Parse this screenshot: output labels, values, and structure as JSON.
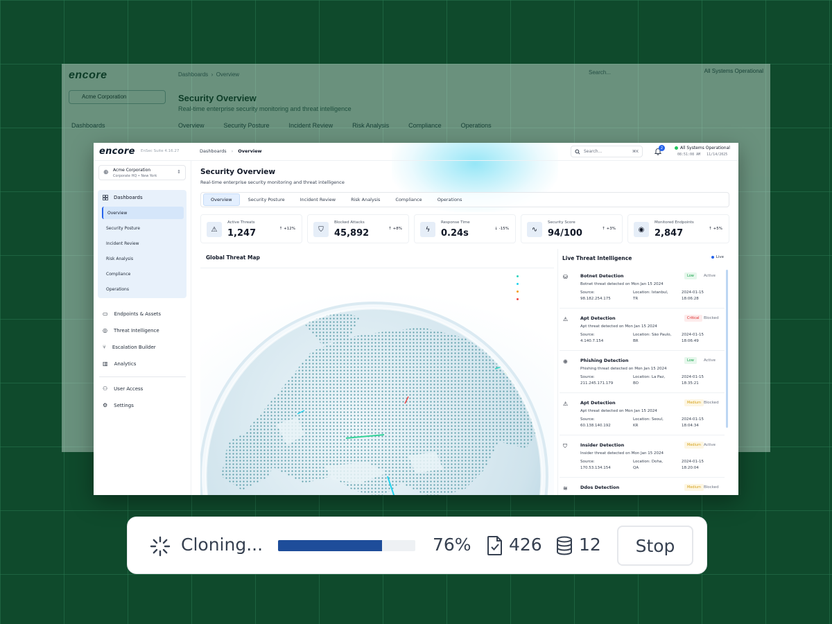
{
  "background_app": {
    "logo": "encore",
    "title": "Security Overview",
    "subtitle": "Real-time enterprise security monitoring and threat intelligence",
    "breadcrumb": [
      "Dashboards",
      "Overview"
    ],
    "tabs": [
      "Overview",
      "Security Posture",
      "Incident Review",
      "Risk Analysis",
      "Compliance",
      "Operations"
    ],
    "org_name": "Acme Corporation",
    "nav_dashboards": "Dashboards",
    "search": "Search...",
    "status": "All Systems Operational"
  },
  "app": {
    "logo": "encore",
    "version": "EnSec Suite 4.16.27",
    "breadcrumb": {
      "parent": "Dashboards",
      "current": "Overview"
    },
    "search": {
      "placeholder": "Search...",
      "shortcut": "⌘K"
    },
    "notifications": {
      "count": "2"
    },
    "system": {
      "status": "All Systems Operational",
      "time": "08:51:08 AM",
      "date": "11/14/2025"
    }
  },
  "sidebar": {
    "org": {
      "name": "Acme Corporation",
      "location": "Corporate HQ • New York"
    },
    "dashboards": {
      "label": "Dashboards",
      "items": [
        "Overview",
        "Security Posture",
        "Incident Review",
        "Risk Analysis",
        "Compliance",
        "Operations"
      ]
    },
    "items": [
      {
        "label": "Endpoints & Assets",
        "icon": "laptop-icon"
      },
      {
        "label": "Threat Intelligence",
        "icon": "radar-icon"
      },
      {
        "label": "Escalation Builder",
        "icon": "branch-icon"
      },
      {
        "label": "Analytics",
        "icon": "chart-icon"
      }
    ],
    "items2": [
      {
        "label": "User Access",
        "icon": "users-icon"
      },
      {
        "label": "Settings",
        "icon": "gear-icon"
      }
    ]
  },
  "main": {
    "title": "Security Overview",
    "subtitle": "Real-time enterprise security monitoring and threat intelligence",
    "tabs": [
      "Overview",
      "Security Posture",
      "Incident Review",
      "Risk Analysis",
      "Compliance",
      "Operations"
    ],
    "stats": [
      {
        "label": "Active Threats",
        "value": "1,247",
        "change": "↑ +12%",
        "icon": "warning-icon"
      },
      {
        "label": "Blocked Attacks",
        "value": "45,892",
        "change": "↑ +8%",
        "icon": "shield-icon"
      },
      {
        "label": "Response Time",
        "value": "0.24s",
        "change": "↓ -15%",
        "icon": "bolt-icon"
      },
      {
        "label": "Security Score",
        "value": "94/100",
        "change": "↑ +3%",
        "icon": "pulse-icon"
      },
      {
        "label": "Monitored Endpoints",
        "value": "2,847",
        "change": "↑ +5%",
        "icon": "eye-icon"
      }
    ],
    "map": {
      "title": "Global Threat Map",
      "legend_colors": [
        "#2dd4bf",
        "#22d3ee",
        "#f59e0b",
        "#ef4444"
      ]
    },
    "threats": {
      "title": "Live Threat Intelligence",
      "live": "Live",
      "source_label": "Source:",
      "location_label": "Location:",
      "items": [
        {
          "name": "Botnet Detection",
          "severity": "Low",
          "status": "Active",
          "desc": "Botnet threat detected on Mon Jan 15 2024",
          "ip": "98.182.254.175",
          "loc1": "Istanbul,",
          "loc2": "TR",
          "date": "2024-01-15",
          "time": "18:06:28",
          "icon": "database-icon"
        },
        {
          "name": "Apt Detection",
          "severity": "Critical",
          "status": "Blocked",
          "desc": "Apt threat detected on Mon Jan 15 2024",
          "ip": "4.140.7.154",
          "loc1": "São Paulo,",
          "loc2": "BR",
          "date": "2024-01-15",
          "time": "18:06:49",
          "icon": "warning-icon"
        },
        {
          "name": "Phishing Detection",
          "severity": "Low",
          "status": "Active",
          "desc": "Phishing threat detected on Mon Jan 15 2024",
          "ip": "211.245.171.179",
          "loc1": "La Paz,",
          "loc2": "BO",
          "date": "2024-01-15",
          "time": "18:35:21",
          "icon": "globe-icon"
        },
        {
          "name": "Apt Detection",
          "severity": "Medium",
          "status": "Blocked",
          "desc": "Apt threat detected on Mon Jan 15 2024",
          "ip": "60.138.140.192",
          "loc1": "Seoul,",
          "loc2": "KR",
          "date": "2024-01-15",
          "time": "18:04:34",
          "icon": "warning-icon"
        },
        {
          "name": "Insider Detection",
          "severity": "Medium",
          "status": "Active",
          "desc": "Insider threat detected on Mon Jan 15 2024",
          "ip": "170.53.134.154",
          "loc1": "Doha,",
          "loc2": "QA",
          "date": "2024-01-15",
          "time": "18:20:04",
          "icon": "shield-icon"
        },
        {
          "name": "Ddos Detection",
          "severity": "Medium",
          "status": "Blocked",
          "desc": "",
          "ip": "",
          "loc1": "",
          "loc2": "",
          "date": "",
          "time": "",
          "icon": "wifi-icon"
        }
      ]
    }
  },
  "clone_bar": {
    "label": "Cloning...",
    "progress": 0.76,
    "percent": "76%",
    "files": "426",
    "databases": "12",
    "stop": "Stop",
    "accent": "#1e4d9a"
  }
}
